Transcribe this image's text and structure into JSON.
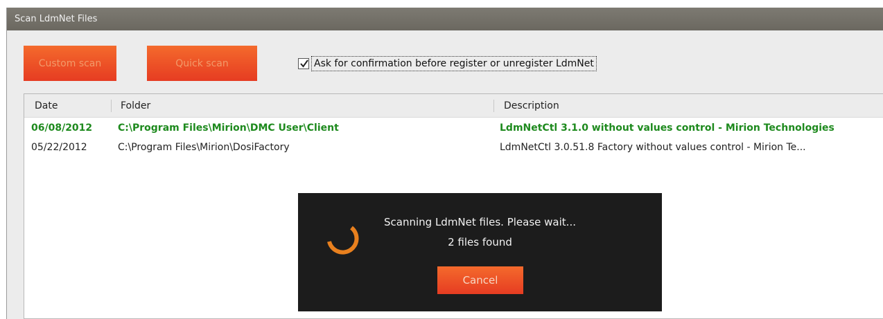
{
  "window": {
    "title": "Scan LdmNet Files"
  },
  "toolbar": {
    "custom_scan_label": "Custom scan",
    "quick_scan_label": "Quick scan",
    "confirm_checkbox_label": "Ask for confirmation before register or unregister LdmNet",
    "confirm_checked": true
  },
  "table": {
    "columns": [
      "Date",
      "Folder",
      "Description"
    ],
    "rows": [
      {
        "date": "06/08/2012",
        "folder": "C:\\Program Files\\Mirion\\DMC User\\Client",
        "description": "LdmNetCtl 3.1.0 without values control - Mirion Technologies"
      },
      {
        "date": "05/22/2012",
        "folder": "C:\\Program Files\\Mirion\\DosiFactory",
        "description": "LdmNetCtl 3.0.51.8 Factory without values control - Mirion Te..."
      }
    ]
  },
  "overlay": {
    "message": "Scanning LdmNet files. Please wait...",
    "count_text": "2 files found",
    "cancel_label": "Cancel"
  },
  "colors": {
    "accent_orange": "#e9471f",
    "highlight_green": "#1e8a1e",
    "titlebar": "#716e66",
    "overlay_bg": "#1c1c1c"
  },
  "icons": {
    "spinner": "loading-spinner-icon",
    "check": "check-icon"
  }
}
